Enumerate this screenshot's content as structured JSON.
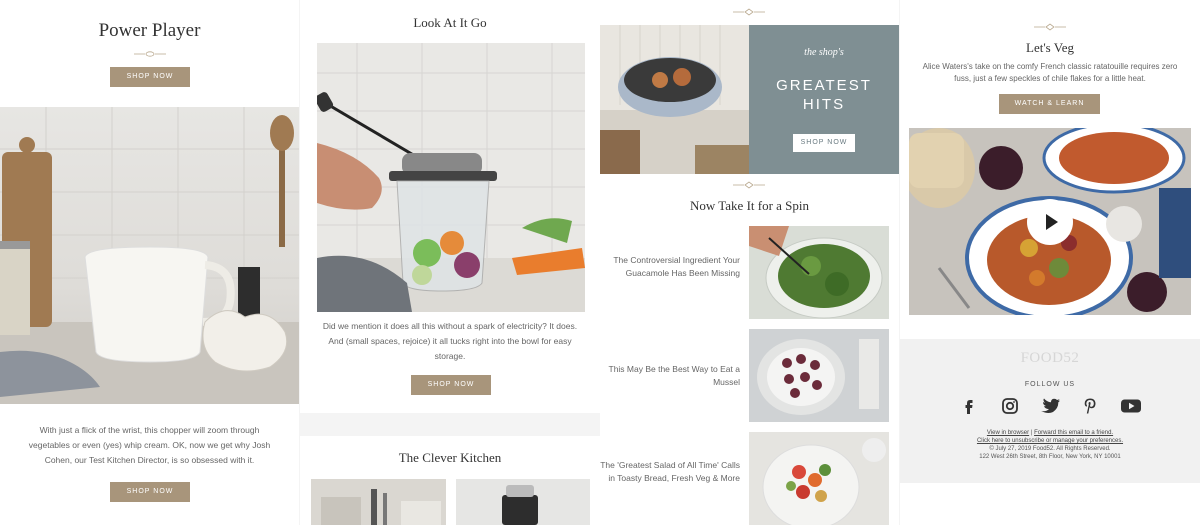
{
  "column1": {
    "title": "Power Player",
    "shop_now_top": "SHOP NOW",
    "body": "With just a flick of the wrist, this chopper will zoom through vegetables or even (yes) whip cream. OK, now we get why Josh Cohen, our Test Kitchen Director, is so obsessed with it.",
    "shop_now_bottom": "SHOP NOW"
  },
  "column2": {
    "title": "Look At It Go",
    "body": "Did we mention it does all this without a spark of electricity? It does. And (small spaces, rejoice) it all tucks right into the bowl for easy storage.",
    "shop_now": "SHOP NOW",
    "title2": "The Clever Kitchen"
  },
  "column3": {
    "hero": {
      "kicker": "the shop's",
      "headline_line1": "GREATEST",
      "headline_line2": "HITS",
      "button": "SHOP NOW"
    },
    "section_title": "Now Take It for a Spin",
    "articles": [
      {
        "title": "The Controversial Ingredient Your Guacamole Has Been Missing"
      },
      {
        "title": "This May Be the Best Way to Eat a Mussel"
      },
      {
        "title": "The 'Greatest Salad of All Time' Calls in Toasty Bread, Fresh Veg & More"
      }
    ]
  },
  "column4": {
    "title": "Let's Veg",
    "body": "Alice Waters's take on the comfy French classic ratatouille requires zero fuss, just a few speckles of chile flakes for a little heat.",
    "button": "WATCH & LEARN",
    "footer": {
      "logo": "FOOD52",
      "follow_us": "FOLLOW US",
      "social_icons": [
        "facebook-icon",
        "instagram-icon",
        "twitter-icon",
        "pinterest-icon",
        "youtube-icon"
      ],
      "view_in_browser": "View in browser",
      "separator": " | ",
      "forward": "Forward this email to a friend.",
      "unsubscribe": "Click here to unsubscribe or manage your preferences.",
      "copyright": "© July 27, 2019 Food52. All Rights Reserved.",
      "address": "122 West 26th Street, 8th Floor, New York, NY 10001"
    }
  },
  "colors": {
    "button_tan": "#a8957b",
    "hero_slate": "#7f8f93",
    "background_gray": "#f4f4f4"
  }
}
